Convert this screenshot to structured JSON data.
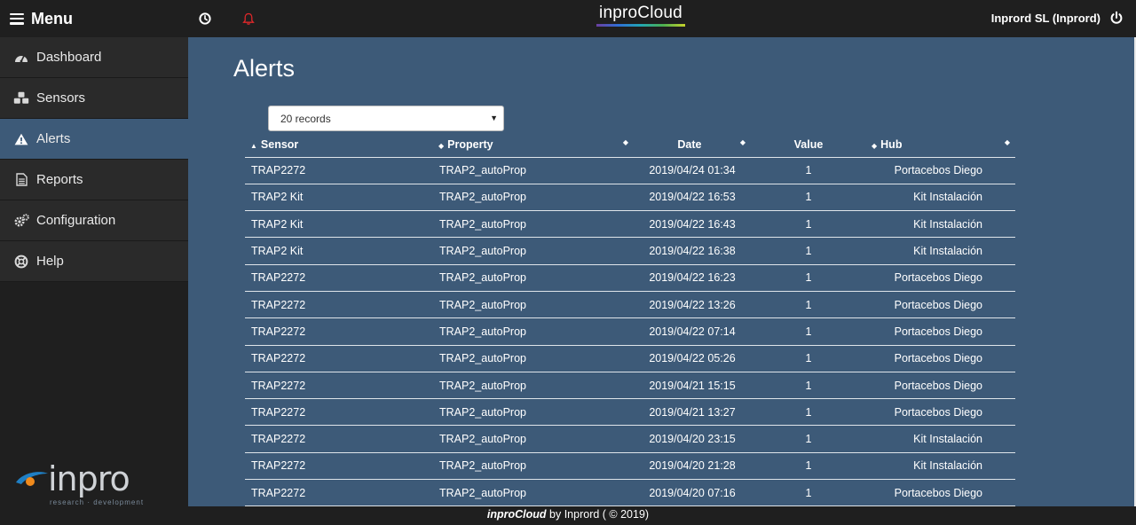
{
  "topbar": {
    "menu_label": "Menu",
    "brand": "inproCloud",
    "account": "Inprord SL (Inprord)",
    "icons": [
      "history-icon",
      "bell-icon",
      "power-icon"
    ],
    "alert_color": "#e0282a"
  },
  "sidebar": {
    "items": [
      {
        "label": "Dashboard",
        "icon": "dashboard-icon"
      },
      {
        "label": "Sensors",
        "icon": "cubes-icon"
      },
      {
        "label": "Alerts",
        "icon": "warning-icon",
        "active": true
      },
      {
        "label": "Reports",
        "icon": "file-text-icon"
      },
      {
        "label": "Configuration",
        "icon": "cogs-icon"
      },
      {
        "label": "Help",
        "icon": "life-ring-icon"
      }
    ],
    "logo_text": "inpro",
    "logo_tagline": "research · development"
  },
  "main": {
    "title": "Alerts",
    "records_select": {
      "value": "20 records"
    },
    "table": {
      "columns": [
        "Sensor",
        "Property",
        "Date",
        "Value",
        "Hub"
      ],
      "rows": [
        [
          "TRAP2272",
          "TRAP2_autoProp",
          "2019/04/24 01:34",
          "1",
          "Portacebos Diego"
        ],
        [
          "TRAP2 Kit",
          "TRAP2_autoProp",
          "2019/04/22 16:53",
          "1",
          "Kit Instalación"
        ],
        [
          "TRAP2 Kit",
          "TRAP2_autoProp",
          "2019/04/22 16:43",
          "1",
          "Kit Instalación"
        ],
        [
          "TRAP2 Kit",
          "TRAP2_autoProp",
          "2019/04/22 16:38",
          "1",
          "Kit Instalación"
        ],
        [
          "TRAP2272",
          "TRAP2_autoProp",
          "2019/04/22 16:23",
          "1",
          "Portacebos Diego"
        ],
        [
          "TRAP2272",
          "TRAP2_autoProp",
          "2019/04/22 13:26",
          "1",
          "Portacebos Diego"
        ],
        [
          "TRAP2272",
          "TRAP2_autoProp",
          "2019/04/22 07:14",
          "1",
          "Portacebos Diego"
        ],
        [
          "TRAP2272",
          "TRAP2_autoProp",
          "2019/04/22 05:26",
          "1",
          "Portacebos Diego"
        ],
        [
          "TRAP2272",
          "TRAP2_autoProp",
          "2019/04/21 15:15",
          "1",
          "Portacebos Diego"
        ],
        [
          "TRAP2272",
          "TRAP2_autoProp",
          "2019/04/21 13:27",
          "1",
          "Portacebos Diego"
        ],
        [
          "TRAP2272",
          "TRAP2_autoProp",
          "2019/04/20 23:15",
          "1",
          "Kit Instalación"
        ],
        [
          "TRAP2272",
          "TRAP2_autoProp",
          "2019/04/20 21:28",
          "1",
          "Kit Instalación"
        ],
        [
          "TRAP2272",
          "TRAP2_autoProp",
          "2019/04/20 07:16",
          "1",
          "Portacebos Diego"
        ]
      ]
    }
  },
  "footer": {
    "brand": "inproCloud",
    "text": " by Inprord ( © 2019)"
  }
}
